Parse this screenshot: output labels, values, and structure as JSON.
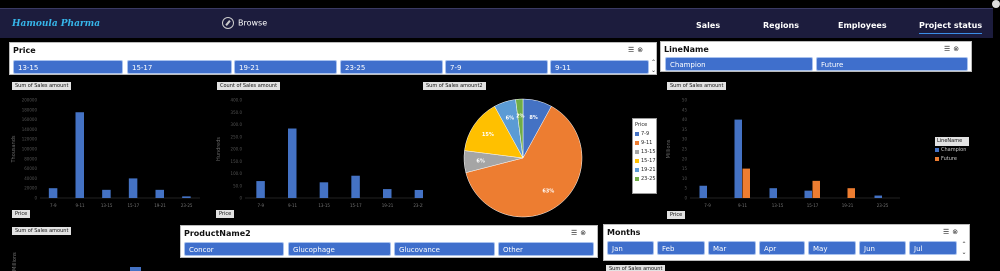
{
  "brand": "Hamoula Pharma",
  "browse_label": "Browse",
  "nav": [
    {
      "label": "Sales"
    },
    {
      "label": "Regions"
    },
    {
      "label": "Employees"
    },
    {
      "label": "Project status"
    }
  ],
  "slicers": {
    "price": {
      "title": "Price",
      "items": [
        "13-15",
        "15-17",
        "19-21",
        "23-25",
        "7-9",
        "9-11"
      ]
    },
    "linename": {
      "title": "LineName",
      "items": [
        "Champion",
        "Future"
      ]
    },
    "product": {
      "title": "ProductName2",
      "items": [
        "Concor",
        "Glucophage",
        "Glucovance",
        "Other"
      ]
    },
    "months": {
      "title": "Months",
      "items": [
        "Jan",
        "Feb",
        "Mar",
        "Apr",
        "May",
        "Jun",
        "Jul"
      ]
    }
  },
  "field_buttons": {
    "sum_sales": "Sum of Sales amount",
    "count_sales": "Count of Sales amount",
    "sum_sales2": "Sum of Sales amount2",
    "price": "Price",
    "linename": "LineName",
    "fourth_unit": "Millions"
  },
  "colors": {
    "blue": "#4472c4",
    "orange": "#ed7d31",
    "gray": "#a5a5a5",
    "yellow": "#ffc000",
    "lightblue": "#5b9bd5",
    "green": "#70ad47"
  },
  "chart_data": [
    {
      "type": "bar",
      "id": "sum-sales",
      "categories": [
        "7-9",
        "9-11",
        "13-15",
        "15-17",
        "19-21",
        "23-25"
      ],
      "values": [
        12000,
        105000,
        10000,
        24000,
        10000,
        2000
      ],
      "ylabel": "Thousands",
      "ytick_labels": [
        "0",
        "20000",
        "40000",
        "60000",
        "80000",
        "100000",
        "120000",
        "140000",
        "160000",
        "180000",
        "200000"
      ],
      "ylim": [
        0,
        120000
      ]
    },
    {
      "type": "bar",
      "id": "count-sales",
      "categories": [
        "7-9",
        "9-11",
        "13-15",
        "15-17",
        "19-21",
        "23-25"
      ],
      "values": [
        95,
        390,
        88,
        125,
        50,
        45
      ],
      "ylabel": "Hundreds",
      "ytick_labels": [
        "0",
        "50.0",
        "100.0",
        "150.0",
        "200.0",
        "250.0",
        "300.0",
        "350.0",
        "400.0"
      ],
      "ylim": [
        0,
        550
      ]
    },
    {
      "type": "pie",
      "id": "sum-sales2",
      "categories": [
        "7-9",
        "9-11",
        "13-15",
        "15-17",
        "19-21",
        "23-25"
      ],
      "values": [
        8,
        63,
        6,
        15,
        6,
        2
      ],
      "labels": [
        "8%",
        "63%",
        "6%",
        "15%",
        "6%",
        "2%"
      ]
    },
    {
      "type": "bar",
      "id": "linename",
      "categories": [
        "7-9",
        "9-11",
        "13-15",
        "15-17",
        "19-21",
        "23-25"
      ],
      "series": [
        {
          "name": "Champion",
          "values": [
            5,
            32,
            4,
            3,
            0,
            1
          ]
        },
        {
          "name": "Future",
          "values": [
            0,
            12,
            0,
            7,
            4,
            0
          ]
        }
      ],
      "ylabel": "Millions",
      "ytick_labels": [
        "0",
        "5",
        "10",
        "15",
        "20",
        "25",
        "30",
        "35",
        "40",
        "45",
        "50"
      ],
      "ylim": [
        0,
        40
      ]
    }
  ]
}
